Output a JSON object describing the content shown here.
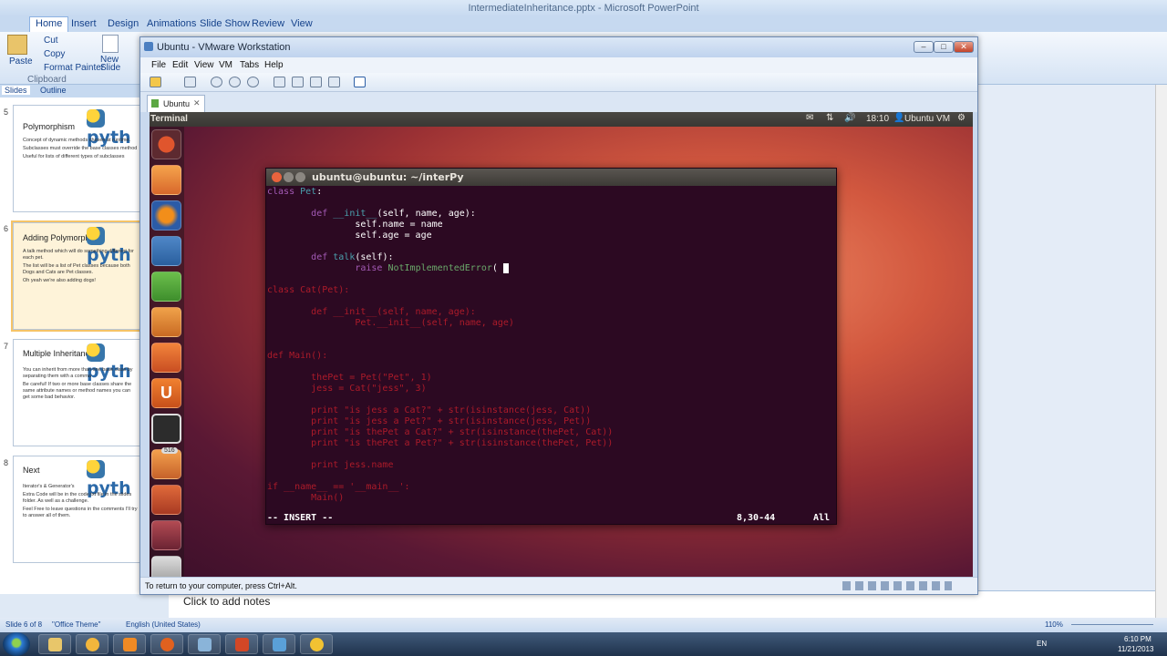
{
  "ppt": {
    "title": "IntermediateInheritance.pptx - Microsoft PowerPoint",
    "tabs": [
      "Home",
      "Insert",
      "Design",
      "Animations",
      "Slide Show",
      "Review",
      "View"
    ],
    "clipboard": {
      "paste": "Paste",
      "cut": "Cut",
      "copy": "Copy",
      "format_painter": "Format Painter",
      "group": "Clipboard"
    },
    "new_slide": "New Slide",
    "pane_tabs": {
      "slides": "Slides",
      "outline": "Outline"
    },
    "slides": [
      {
        "num": "5",
        "title": "Polymorphism",
        "bullets": [
          "Concept of dynamic methods chosen at runtime.",
          "Subclasses must override the base classes method",
          "Useful for lists of different types of subclasses"
        ]
      },
      {
        "num": "6",
        "title": "Adding Polymorphism",
        "bullets": [
          "A talk method which will do something different for each pet.",
          "The list will be a list of Pet classes because both Dogs and Cats are Pet classes.",
          "Oh yeah we're also adding dogs!"
        ]
      },
      {
        "num": "7",
        "title": "Multiple Inheritance",
        "bullets": [
          "You can inherit from more than one base class by separating them with a comma",
          "Be careful! If two or more base classes share the same attribute names or method names you can get some bad behavior."
        ]
      },
      {
        "num": "8",
        "title": "Next",
        "bullets": [
          "Iterator's & Generator's",
          "Extra Code will be in the code.txt file in the slides folder. As well as a challenge.",
          "Feel Free to leave questions in the comments I'll try to answer all of them."
        ]
      }
    ],
    "logo_text": "pyth",
    "notes": "Click to add notes",
    "status": {
      "slide": "Slide 6 of 8",
      "theme": "\"Office Theme\"",
      "lang": "English (United States)",
      "zoom": "110%"
    }
  },
  "taskbar": {
    "lang": "EN",
    "time": "6:10 PM",
    "date": "11/21/2013"
  },
  "vmware": {
    "title": "Ubuntu - VMware Workstation",
    "menu": [
      "File",
      "Edit",
      "View",
      "VM",
      "Tabs",
      "Help"
    ],
    "tab": "Ubuntu",
    "status_hint": "To return to your computer, press Ctrl+Alt."
  },
  "ubuntu": {
    "panel_title": "Terminal",
    "time": "18:10",
    "user": "Ubuntu VM",
    "launcher_badge": "516"
  },
  "terminal": {
    "title": "ubuntu@ubuntu: ~/interPy",
    "mode": "-- INSERT --",
    "position": "8,30-44",
    "scroll": "All"
  },
  "code_lines": [
    {
      "t": "class Pet:",
      "kind": "a"
    },
    {
      "t": "",
      "kind": "a"
    },
    {
      "t": "        def __init__(self, name, age):",
      "kind": "b"
    },
    {
      "t": "                self.name = name",
      "kind": "w"
    },
    {
      "t": "                self.age = age",
      "kind": "w"
    },
    {
      "t": "",
      "kind": "w"
    },
    {
      "t": "        def talk(self):",
      "kind": "c"
    },
    {
      "t": "                raise NotImplementedError( ",
      "kind": "cur"
    },
    {
      "t": "",
      "kind": "w"
    },
    {
      "t": "class Cat(Pet):",
      "kind": "d"
    },
    {
      "t": "",
      "kind": "d"
    },
    {
      "t": "        def __init__(self, name, age):",
      "kind": "d"
    },
    {
      "t": "                Pet.__init__(self, name, age)",
      "kind": "d"
    },
    {
      "t": "",
      "kind": "d"
    },
    {
      "t": "",
      "kind": "d"
    },
    {
      "t": "def Main():",
      "kind": "d"
    },
    {
      "t": "",
      "kind": "d"
    },
    {
      "t": "        thePet = Pet(\"Pet\", 1)",
      "kind": "d"
    },
    {
      "t": "        jess = Cat(\"jess\", 3)",
      "kind": "d"
    },
    {
      "t": "",
      "kind": "d"
    },
    {
      "t": "        print \"is jess a Cat?\" + str(isinstance(jess, Cat))",
      "kind": "d"
    },
    {
      "t": "        print \"is jess a Pet?\" + str(isinstance(jess, Pet))",
      "kind": "d"
    },
    {
      "t": "        print \"is thePet a Cat?\" + str(isinstance(thePet, Cat))",
      "kind": "d"
    },
    {
      "t": "        print \"is thePet a Pet?\" + str(isinstance(thePet, Pet))",
      "kind": "d"
    },
    {
      "t": "",
      "kind": "d"
    },
    {
      "t": "        print jess.name",
      "kind": "d"
    },
    {
      "t": "",
      "kind": "d"
    },
    {
      "t": "if __name__ == '__main__':",
      "kind": "d"
    },
    {
      "t": "        Main()",
      "kind": "d"
    }
  ]
}
